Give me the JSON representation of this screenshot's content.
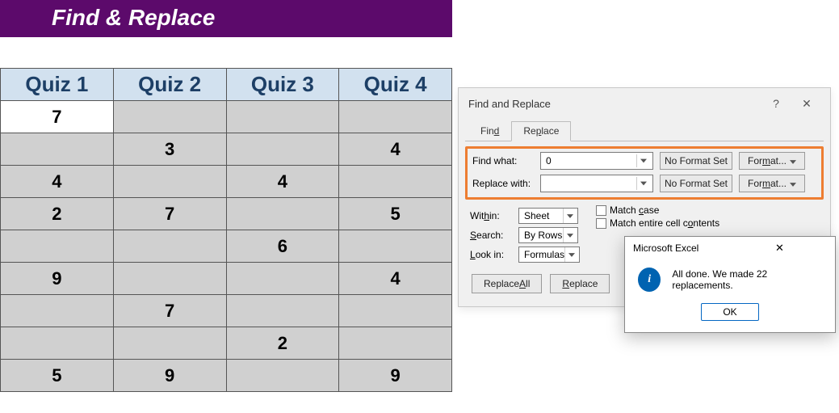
{
  "header": {
    "title": "Find & Replace"
  },
  "table": {
    "headers": [
      "Quiz 1",
      "Quiz 2",
      "Quiz 3",
      "Quiz 4"
    ],
    "rows": [
      [
        "7",
        "",
        "",
        ""
      ],
      [
        "",
        "3",
        "",
        "4"
      ],
      [
        "4",
        "",
        "4",
        ""
      ],
      [
        "2",
        "7",
        "",
        "5"
      ],
      [
        "",
        "",
        "6",
        ""
      ],
      [
        "9",
        "",
        "",
        "4"
      ],
      [
        "",
        "7",
        "",
        ""
      ],
      [
        "",
        "",
        "2",
        ""
      ],
      [
        "5",
        "9",
        "",
        "9"
      ]
    ],
    "active_cell": [
      0,
      0
    ]
  },
  "dialog": {
    "title": "Find and Replace",
    "tabs": {
      "find": "Find",
      "replace": "Replace",
      "active": "replace"
    },
    "find_what_label": "Find what:",
    "find_what_value": "0",
    "replace_with_label": "Replace with:",
    "replace_with_value": "",
    "no_format": "No Format Set",
    "format": "Format...",
    "within_label": "Within:",
    "within_value": "Sheet",
    "search_label": "Search:",
    "search_value": "By Rows",
    "lookin_label": "Look in:",
    "lookin_value": "Formulas",
    "match_case": "Match case",
    "match_entire": "Match entire cell contents",
    "replace_all": "Replace All",
    "replace_btn": "Replace",
    "help": "?",
    "close": "✕"
  },
  "msgbox": {
    "title": "Microsoft Excel",
    "text": "All done. We made 22 replacements.",
    "ok": "OK",
    "close": "✕"
  }
}
